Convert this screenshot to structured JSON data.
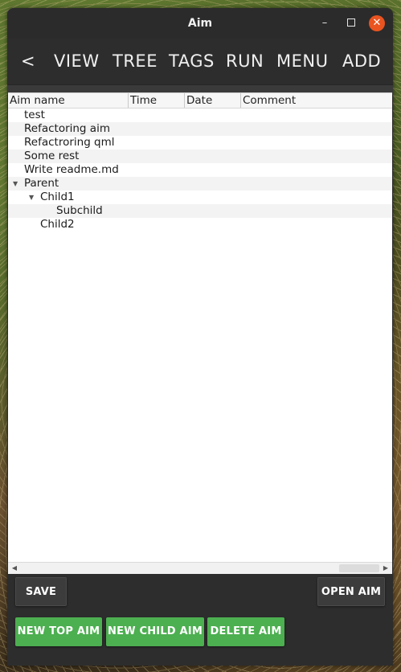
{
  "window": {
    "title": "Aim"
  },
  "window_controls": {
    "minimize": "–",
    "close": "✕"
  },
  "toolbar": {
    "back": "<",
    "view": "VIEW",
    "tree": "TREE",
    "tags": "TAGS",
    "run": "RUN",
    "menu": "MENU",
    "add": "ADD"
  },
  "tree": {
    "columns": [
      "Aim name",
      "Time",
      "Date",
      "Comment"
    ],
    "rows": [
      {
        "name": "test"
      },
      {
        "name": "Refactoring aim"
      },
      {
        "name": "Refactroring qml"
      },
      {
        "name": "Some rest"
      },
      {
        "name": "Write readme.md"
      },
      {
        "name": "Parent",
        "expanded": true
      },
      {
        "name": "Child1",
        "expanded": true
      },
      {
        "name": "Subchild"
      },
      {
        "name": "Child2"
      }
    ]
  },
  "buttons": {
    "save": "SAVE",
    "open_aim": "OPEN AIM",
    "new_top_aim": "NEW TOP AIM",
    "new_child_aim": "NEW CHILD AIM",
    "delete_aim": "DELETE AIM"
  },
  "colors": {
    "accent_green": "#4caf50",
    "close_orange": "#e95420",
    "window_bg": "#2d2d2d"
  },
  "icons": {
    "expand": "triangle-down",
    "scroll_left": "triangle-left",
    "scroll_right": "triangle-right"
  }
}
